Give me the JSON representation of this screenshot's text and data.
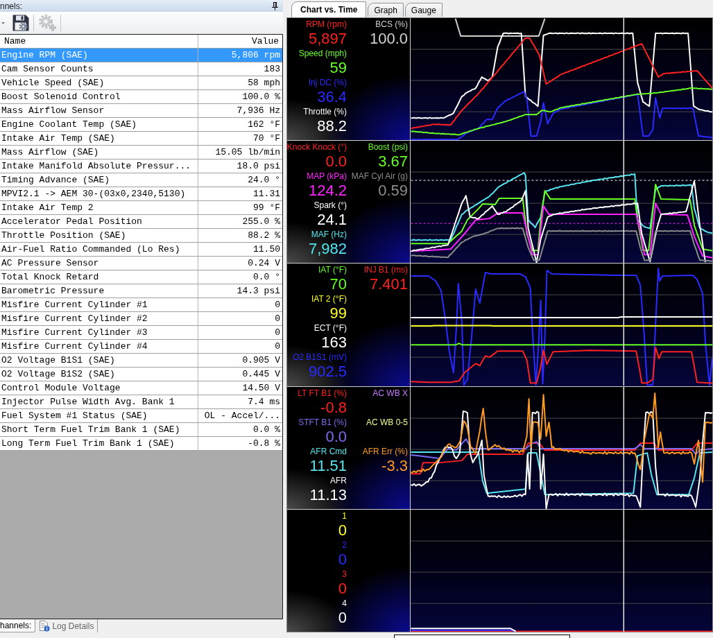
{
  "left_panel": {
    "title": "nnels:",
    "toolbar": [
      {
        "kind": "save",
        "disabled": false
      },
      {
        "kind": "add",
        "disabled": true
      }
    ],
    "table": {
      "columns": [
        "Name",
        "Value"
      ],
      "rows": [
        {
          "name": "Engine RPM (SAE)",
          "value": "5,806 rpm",
          "selected": true
        },
        {
          "name": "Cam Sensor Counts",
          "value": "183",
          "selected": false
        },
        {
          "name": "Vehicle Speed (SAE)",
          "value": "58 mph",
          "selected": false
        },
        {
          "name": "Boost Solenoid Control",
          "value": "100.0 %",
          "selected": false
        },
        {
          "name": "Mass Airflow Sensor",
          "value": "7,936 Hz",
          "selected": false
        },
        {
          "name": "Engine Coolant Temp (SAE)",
          "value": "162 °F",
          "selected": false
        },
        {
          "name": "Intake Air Temp (SAE)",
          "value": "70 °F",
          "selected": false
        },
        {
          "name": "Mass Airflow (SAE)",
          "value": "15.05 lb/min",
          "selected": false
        },
        {
          "name": "Intake Manifold Absolute Pressur...",
          "value": "18.0 psi",
          "selected": false
        },
        {
          "name": "Timing Advance (SAE)",
          "value": "24.0 °",
          "selected": false
        },
        {
          "name": "MPVI2.1 -> AEM 30-(03x0,2340,5130)",
          "value": "11.31",
          "selected": false
        },
        {
          "name": "Intake Air Temp 2",
          "value": "99 °F",
          "selected": false
        },
        {
          "name": "Accelerator Pedal Position",
          "value": "255.0 %",
          "selected": false
        },
        {
          "name": "Throttle Position (SAE)",
          "value": "88.2 %",
          "selected": false
        },
        {
          "name": "Air-Fuel Ratio Commanded (Lo Res)",
          "value": "11.50",
          "selected": false
        },
        {
          "name": "AC Pressure Sensor",
          "value": "0.24 V",
          "selected": false
        },
        {
          "name": "Total Knock Retard",
          "value": "0.0 °",
          "selected": false
        },
        {
          "name": "Barometric Pressure",
          "value": "14.3 psi",
          "selected": false
        },
        {
          "name": "Misfire Current Cylinder #1",
          "value": "0",
          "selected": false
        },
        {
          "name": "Misfire Current Cylinder #2",
          "value": "0",
          "selected": false
        },
        {
          "name": "Misfire Current Cylinder #3",
          "value": "0",
          "selected": false
        },
        {
          "name": "Misfire Current Cylinder #4",
          "value": "0",
          "selected": false
        },
        {
          "name": "O2 Voltage B1S1 (SAE)",
          "value": "0.905 V",
          "selected": false
        },
        {
          "name": "O2 Voltage B1S2 (SAE)",
          "value": "0.445 V",
          "selected": false
        },
        {
          "name": "Control Module Voltage",
          "value": "14.50 V",
          "selected": false
        },
        {
          "name": "Injector Pulse Width Avg. Bank 1",
          "value": "7.4 ms",
          "selected": false
        },
        {
          "name": "Fuel System #1 Status (SAE)",
          "value": "OL - Accel/...",
          "selected": false
        },
        {
          "name": "Short Term Fuel Trim Bank 1 (SAE)",
          "value": "0.0 %",
          "selected": false
        },
        {
          "name": "Long Term Fuel Trim Bank 1 (SAE)",
          "value": "-0.8 %",
          "selected": false
        }
      ]
    },
    "tabs": [
      {
        "label": "hannels:",
        "selected": true,
        "kind": "plain"
      },
      {
        "label": "Log Details",
        "selected": false,
        "kind": "with_icon"
      }
    ]
  },
  "chart_view": {
    "tabs": [
      {
        "label": "Chart vs. Time",
        "selected": true
      },
      {
        "label": "Graph",
        "selected": false
      },
      {
        "label": "Gauge",
        "selected": false
      }
    ],
    "strips": [
      {
        "left_column": [
          {
            "label": "RPM (rpm)",
            "value": "5,897",
            "color": "#ff2020"
          },
          {
            "label": "Speed (mph)",
            "value": "59",
            "color": "#66ff22"
          },
          {
            "label": "Inj DC (%)",
            "value": "36.4",
            "color": "#2a2aff"
          },
          {
            "label": "Throttle (%)",
            "value": "88.2",
            "color": "#ffffff"
          }
        ],
        "right_column": [
          {
            "label": "BCS (%)",
            "value": "100.0",
            "color": "#d0d0d0"
          }
        ]
      },
      {
        "left_column": [
          {
            "label": "Knock Knock (°)",
            "value": "0.0",
            "color": "#ff2020"
          },
          {
            "label": "MAP (kPa)",
            "value": "124.2",
            "color": "#ff22ff"
          },
          {
            "label": "Spark (°)",
            "value": "24.1",
            "color": "#ffffff"
          },
          {
            "label": "MAF (Hz)",
            "value": "7,982",
            "color": "#55e6ee"
          }
        ],
        "right_column": [
          {
            "label": "Boost (psi)",
            "value": "3.67",
            "color": "#66ff22"
          },
          {
            "label": "MAF Cyl Air (g)",
            "value": "0.59",
            "color": "#8c8c8c"
          }
        ]
      },
      {
        "left_column": [
          {
            "label": "IAT (°F)",
            "value": "70",
            "color": "#66ff22"
          },
          {
            "label": "IAT 2 (°F)",
            "value": "99",
            "color": "#ffff22"
          },
          {
            "label": "ECT (°F)",
            "value": "163",
            "color": "#ffffff"
          },
          {
            "label": "O2 B1S1 (mV)",
            "value": "902.5",
            "color": "#2a2aff"
          }
        ],
        "right_column": [
          {
            "label": "INJ B1 (ms)",
            "value": "7.401",
            "color": "#ff2020"
          }
        ]
      },
      {
        "left_column": [
          {
            "label": "LT FT B1 (%)",
            "value": "-0.8",
            "color": "#ff2020"
          },
          {
            "label": "STFT B1 (%)",
            "value": "0.0",
            "color": "#7b6cf0"
          },
          {
            "label": "AFR Cmd",
            "value": "11.51",
            "color": "#55e6ee"
          },
          {
            "label": "AFR",
            "value": "11.13",
            "color": "#ffffff"
          }
        ],
        "right_column": [
          {
            "label": "AC WB X",
            "color": "#c77dff"
          },
          {
            "label": "AC WB 0-5",
            "color": "#eaff8c"
          },
          {
            "label": "AFR Err (%)",
            "value": "-3.3",
            "color": "#ff9a22"
          }
        ]
      },
      {
        "left_column": [
          {
            "label": "1",
            "value": "0",
            "color": "#ffff22"
          },
          {
            "label": "2",
            "value": "0",
            "color": "#2a2aff"
          },
          {
            "label": "3",
            "value": "0",
            "color": "#ff2020"
          },
          {
            "label": "4",
            "value": "0",
            "color": "#ffffff"
          }
        ]
      }
    ]
  }
}
